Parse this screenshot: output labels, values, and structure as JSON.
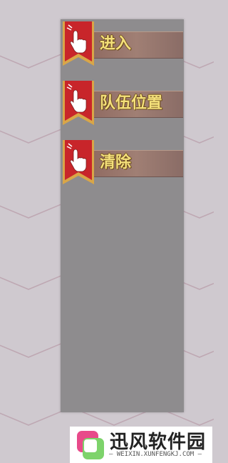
{
  "menu": {
    "items": [
      {
        "label": "进入",
        "icon": "tap-hand-icon"
      },
      {
        "label": "队伍位置",
        "icon": "tap-hand-icon"
      },
      {
        "label": "清除",
        "icon": "tap-hand-icon"
      }
    ]
  },
  "watermark": {
    "title": "迅风软件园",
    "subtitle": "WEIXIN.XUNFENGKJ.COM"
  },
  "colors": {
    "background": "#cfc9cf",
    "panel": "#8e8c8e",
    "ribbon_red": "#c8252a",
    "ribbon_gold": "#d9a648",
    "label_text": "#f4e07a"
  }
}
